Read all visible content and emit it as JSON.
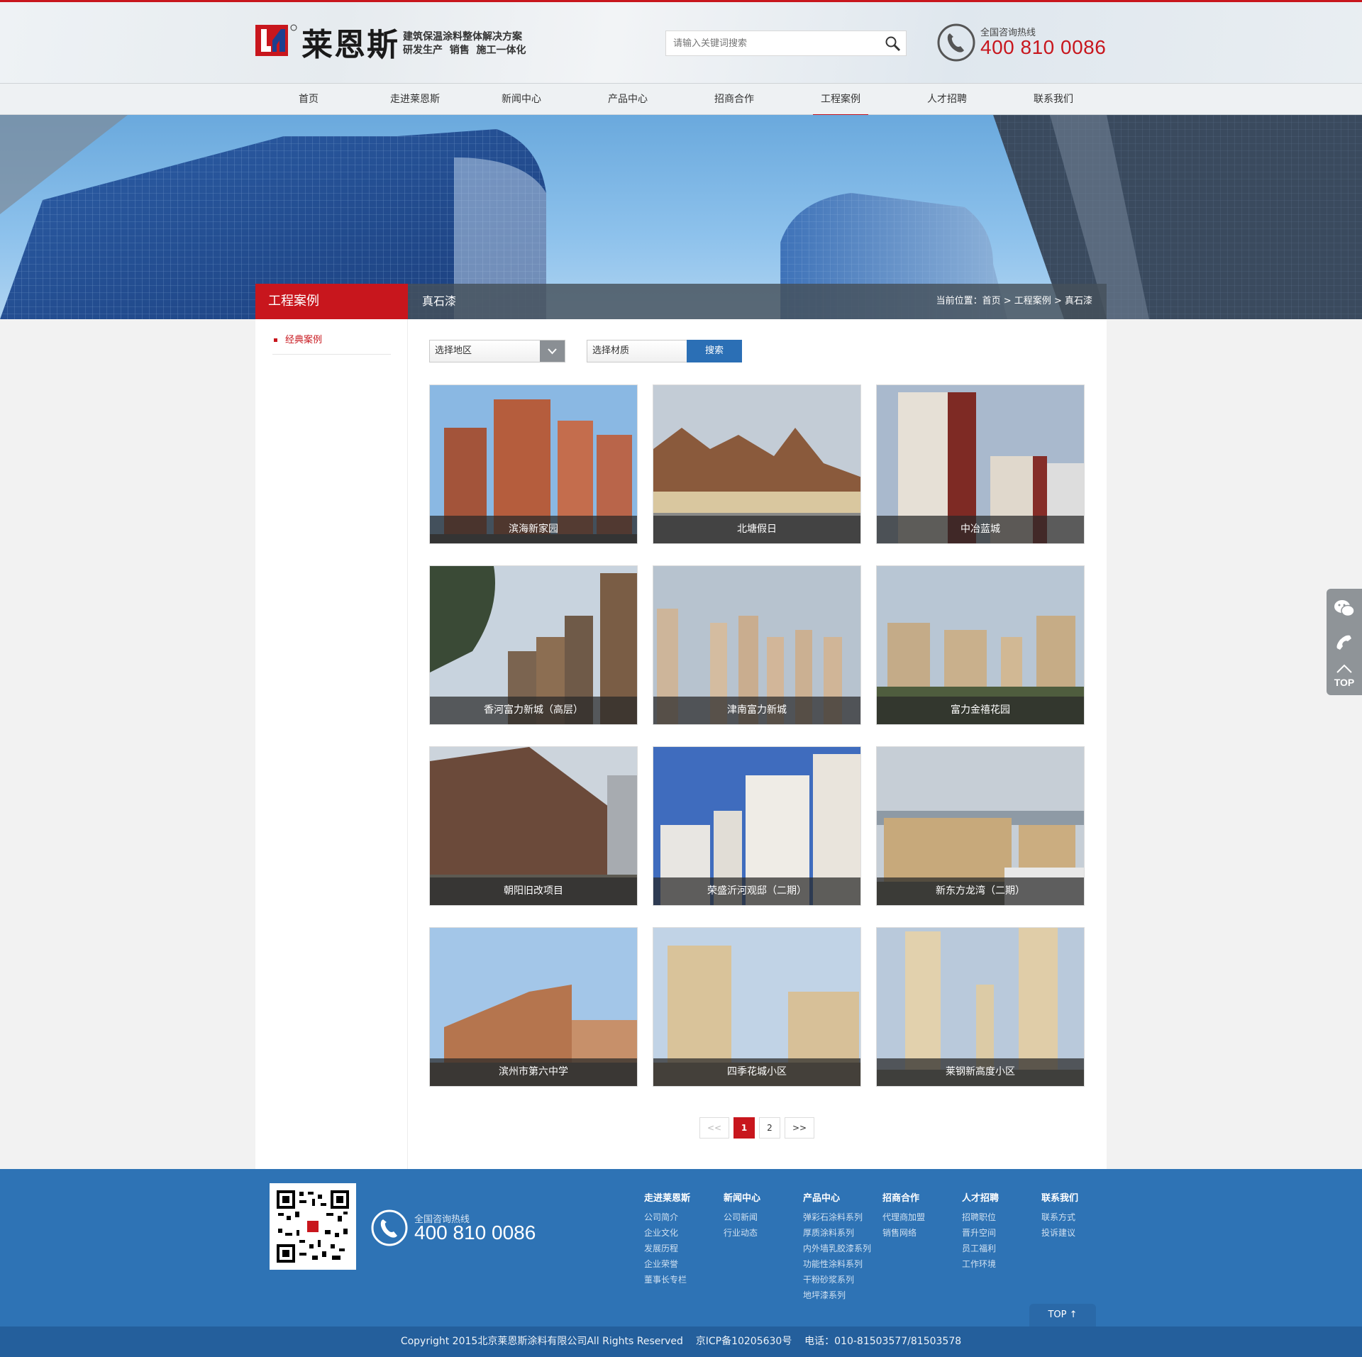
{
  "header": {
    "brand": "莱恩斯",
    "slogan_line1": "建筑保温涂料整体解决方案",
    "slogan_line2": "研发生产  销售  施工一体化",
    "search_placeholder": "请输入关键词搜索",
    "hotline_label": "全国咨询热线",
    "hotline_number": "400 810 0086"
  },
  "nav": {
    "items": [
      "首页",
      "走进莱恩斯",
      "新闻中心",
      "产品中心",
      "招商合作",
      "工程案例",
      "人才招聘",
      "联系我们"
    ],
    "active": "工程案例"
  },
  "subheader": {
    "section_title": "工程案例",
    "current": "真石漆",
    "breadcrumb_prefix": "当前位置：",
    "breadcrumb": [
      "首页",
      " > ",
      "工程案例",
      " > ",
      "真石漆"
    ]
  },
  "sidebar": {
    "items": [
      "经典案例"
    ]
  },
  "filters": {
    "region": "选择地区",
    "material": "选择材质",
    "search_button": "搜索"
  },
  "cases": [
    {
      "title": "滨海新家园"
    },
    {
      "title": "北塘假日"
    },
    {
      "title": "中冶蓝城"
    },
    {
      "title": "香河富力新城（高层）"
    },
    {
      "title": "津南富力新城"
    },
    {
      "title": "富力金禧花园"
    },
    {
      "title": "朝阳旧改项目"
    },
    {
      "title": "荣盛沂河观邸（二期）"
    },
    {
      "title": "新东方龙湾（二期）"
    },
    {
      "title": "滨州市第六中学"
    },
    {
      "title": "四季花城小区"
    },
    {
      "title": "莱钢新高度小区"
    }
  ],
  "pagination": {
    "prev": "<<",
    "pages": [
      "1",
      "2"
    ],
    "current": "1",
    "next": ">>"
  },
  "float_bar": {
    "top_label": "TOP"
  },
  "footer": {
    "hotline_label": "全国咨询热线",
    "hotline_number": "400 810 0086",
    "columns": [
      {
        "title": "走进莱恩斯",
        "links": [
          "公司简介",
          "企业文化",
          "发展历程",
          "企业荣誉",
          "董事长专栏"
        ]
      },
      {
        "title": "新闻中心",
        "links": [
          "公司新闻",
          "行业动态"
        ]
      },
      {
        "title": "产品中心",
        "links": [
          "弹彩石涂料系列",
          "厚质涂料系列",
          "内外墙乳胶漆系列",
          "功能性涂料系列",
          "干粉砂浆系列",
          "地坪漆系列"
        ]
      },
      {
        "title": "招商合作",
        "links": [
          "代理商加盟",
          "销售网络"
        ]
      },
      {
        "title": "人才招聘",
        "links": [
          "招聘职位",
          "晋升空间",
          "员工福利",
          "工作环境"
        ]
      },
      {
        "title": "联系我们",
        "links": [
          "联系方式",
          "投诉建议"
        ]
      }
    ],
    "top_button": "TOP ↑",
    "copyright": "Copyright 2015北京莱恩斯涂料有限公司All Rights Reserved",
    "icp": "京ICP备10205630号",
    "phone": "电话：010-81503577/81503578"
  },
  "colors": {
    "brand_red": "#c8161d",
    "footer_blue": "#2e73b5",
    "search_blue": "#2b6fb5"
  }
}
